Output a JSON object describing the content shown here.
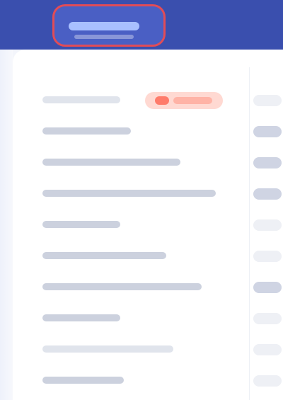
{
  "colors": {
    "header_bg": "#3a4fae",
    "active_tab_border": "#e14c57",
    "panel_bg": "#ffffff",
    "chip_bg": "#ffd9d2",
    "chip_accent": "#ff7b6a"
  },
  "header": {
    "active_tab_label": ""
  },
  "list": {
    "rows": [
      {
        "label": "",
        "has_chip": true,
        "chip_label": ""
      },
      {
        "label": ""
      },
      {
        "label": ""
      },
      {
        "label": ""
      },
      {
        "label": ""
      },
      {
        "label": ""
      },
      {
        "label": ""
      },
      {
        "label": ""
      },
      {
        "label": ""
      },
      {
        "label": ""
      }
    ]
  }
}
